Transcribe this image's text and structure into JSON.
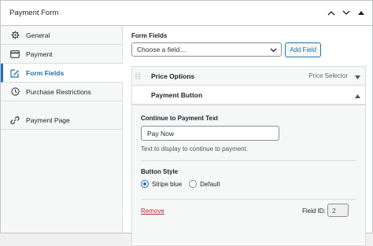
{
  "panel": {
    "title": "Payment Form",
    "controls": [
      "chevron-up-icon",
      "chevron-down-icon",
      "triangle-up-icon"
    ]
  },
  "sidebar": {
    "items": [
      {
        "label": "General",
        "icon": "gear-icon",
        "active": false
      },
      {
        "label": "Payment",
        "icon": "card-icon",
        "active": false
      },
      {
        "label": "Form Fields",
        "icon": "edit-icon",
        "active": true
      },
      {
        "label": "Purchase Restrictions",
        "icon": "clock-icon",
        "active": false
      },
      {
        "label": "Payment Page",
        "icon": "link-icon",
        "active": false
      }
    ]
  },
  "main": {
    "form_fields_label": "Form Fields",
    "select_value": "Choose a field…",
    "add_button_label": "Add Field",
    "fields": [
      {
        "title": "Price Options",
        "tag": "Price Selector",
        "expanded": false
      },
      {
        "title": "Payment Button",
        "tag": "",
        "expanded": true
      }
    ],
    "settings": {
      "continue_label": "Continue to Payment Text",
      "continue_value": "Pay Now",
      "continue_help": "Text to display to continue to payment.",
      "style_label": "Button Style",
      "style_options": [
        {
          "label": "Stripe blue",
          "selected": true
        },
        {
          "label": "Default",
          "selected": false
        }
      ],
      "remove_label": "Remove",
      "field_id_label": "Field ID:",
      "field_id_value": "2"
    }
  },
  "colors": {
    "accent": "#2271b1",
    "danger": "#b32d2e",
    "border": "#dcdcde"
  }
}
